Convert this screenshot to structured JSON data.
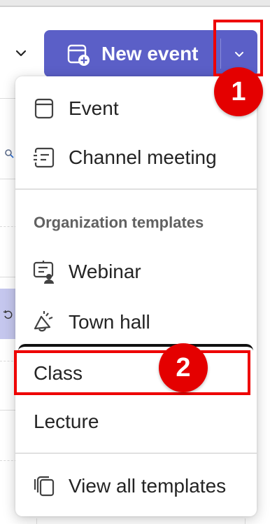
{
  "new_event": {
    "label": "New event",
    "dropdown_icon": "chevron-down-icon",
    "icon": "calendar-add-icon",
    "color": "#5b5fc7"
  },
  "view_selector": {
    "icon": "chevron-down-icon"
  },
  "menu": {
    "items": [
      {
        "label": "Event",
        "icon": "calendar-icon"
      },
      {
        "label": "Channel meeting",
        "icon": "channel-meeting-icon"
      }
    ],
    "section_header": "Organization templates",
    "template_items": [
      {
        "label": "Webinar",
        "icon": "webinar-icon"
      },
      {
        "label": "Town hall",
        "icon": "megaphone-icon"
      },
      {
        "label": "Class"
      },
      {
        "label": "Lecture"
      }
    ],
    "footer_item": {
      "label": "View all templates",
      "icon": "copy-templates-icon"
    }
  },
  "annotations": {
    "step1": "1",
    "step2": "2",
    "color": "#e40000"
  }
}
